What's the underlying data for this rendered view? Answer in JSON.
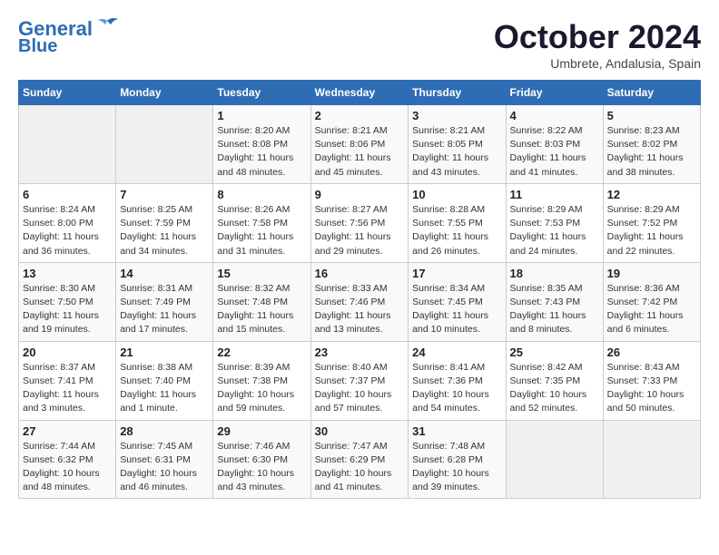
{
  "header": {
    "logo_line1": "General",
    "logo_line2": "Blue",
    "month_title": "October 2024",
    "subtitle": "Umbrete, Andalusia, Spain"
  },
  "calendar": {
    "days_of_week": [
      "Sunday",
      "Monday",
      "Tuesday",
      "Wednesday",
      "Thursday",
      "Friday",
      "Saturday"
    ],
    "weeks": [
      [
        {
          "day": "",
          "info": ""
        },
        {
          "day": "",
          "info": ""
        },
        {
          "day": "1",
          "info": "Sunrise: 8:20 AM\nSunset: 8:08 PM\nDaylight: 11 hours and 48 minutes."
        },
        {
          "day": "2",
          "info": "Sunrise: 8:21 AM\nSunset: 8:06 PM\nDaylight: 11 hours and 45 minutes."
        },
        {
          "day": "3",
          "info": "Sunrise: 8:21 AM\nSunset: 8:05 PM\nDaylight: 11 hours and 43 minutes."
        },
        {
          "day": "4",
          "info": "Sunrise: 8:22 AM\nSunset: 8:03 PM\nDaylight: 11 hours and 41 minutes."
        },
        {
          "day": "5",
          "info": "Sunrise: 8:23 AM\nSunset: 8:02 PM\nDaylight: 11 hours and 38 minutes."
        }
      ],
      [
        {
          "day": "6",
          "info": "Sunrise: 8:24 AM\nSunset: 8:00 PM\nDaylight: 11 hours and 36 minutes."
        },
        {
          "day": "7",
          "info": "Sunrise: 8:25 AM\nSunset: 7:59 PM\nDaylight: 11 hours and 34 minutes."
        },
        {
          "day": "8",
          "info": "Sunrise: 8:26 AM\nSunset: 7:58 PM\nDaylight: 11 hours and 31 minutes."
        },
        {
          "day": "9",
          "info": "Sunrise: 8:27 AM\nSunset: 7:56 PM\nDaylight: 11 hours and 29 minutes."
        },
        {
          "day": "10",
          "info": "Sunrise: 8:28 AM\nSunset: 7:55 PM\nDaylight: 11 hours and 26 minutes."
        },
        {
          "day": "11",
          "info": "Sunrise: 8:29 AM\nSunset: 7:53 PM\nDaylight: 11 hours and 24 minutes."
        },
        {
          "day": "12",
          "info": "Sunrise: 8:29 AM\nSunset: 7:52 PM\nDaylight: 11 hours and 22 minutes."
        }
      ],
      [
        {
          "day": "13",
          "info": "Sunrise: 8:30 AM\nSunset: 7:50 PM\nDaylight: 11 hours and 19 minutes."
        },
        {
          "day": "14",
          "info": "Sunrise: 8:31 AM\nSunset: 7:49 PM\nDaylight: 11 hours and 17 minutes."
        },
        {
          "day": "15",
          "info": "Sunrise: 8:32 AM\nSunset: 7:48 PM\nDaylight: 11 hours and 15 minutes."
        },
        {
          "day": "16",
          "info": "Sunrise: 8:33 AM\nSunset: 7:46 PM\nDaylight: 11 hours and 13 minutes."
        },
        {
          "day": "17",
          "info": "Sunrise: 8:34 AM\nSunset: 7:45 PM\nDaylight: 11 hours and 10 minutes."
        },
        {
          "day": "18",
          "info": "Sunrise: 8:35 AM\nSunset: 7:43 PM\nDaylight: 11 hours and 8 minutes."
        },
        {
          "day": "19",
          "info": "Sunrise: 8:36 AM\nSunset: 7:42 PM\nDaylight: 11 hours and 6 minutes."
        }
      ],
      [
        {
          "day": "20",
          "info": "Sunrise: 8:37 AM\nSunset: 7:41 PM\nDaylight: 11 hours and 3 minutes."
        },
        {
          "day": "21",
          "info": "Sunrise: 8:38 AM\nSunset: 7:40 PM\nDaylight: 11 hours and 1 minute."
        },
        {
          "day": "22",
          "info": "Sunrise: 8:39 AM\nSunset: 7:38 PM\nDaylight: 10 hours and 59 minutes."
        },
        {
          "day": "23",
          "info": "Sunrise: 8:40 AM\nSunset: 7:37 PM\nDaylight: 10 hours and 57 minutes."
        },
        {
          "day": "24",
          "info": "Sunrise: 8:41 AM\nSunset: 7:36 PM\nDaylight: 10 hours and 54 minutes."
        },
        {
          "day": "25",
          "info": "Sunrise: 8:42 AM\nSunset: 7:35 PM\nDaylight: 10 hours and 52 minutes."
        },
        {
          "day": "26",
          "info": "Sunrise: 8:43 AM\nSunset: 7:33 PM\nDaylight: 10 hours and 50 minutes."
        }
      ],
      [
        {
          "day": "27",
          "info": "Sunrise: 7:44 AM\nSunset: 6:32 PM\nDaylight: 10 hours and 48 minutes."
        },
        {
          "day": "28",
          "info": "Sunrise: 7:45 AM\nSunset: 6:31 PM\nDaylight: 10 hours and 46 minutes."
        },
        {
          "day": "29",
          "info": "Sunrise: 7:46 AM\nSunset: 6:30 PM\nDaylight: 10 hours and 43 minutes."
        },
        {
          "day": "30",
          "info": "Sunrise: 7:47 AM\nSunset: 6:29 PM\nDaylight: 10 hours and 41 minutes."
        },
        {
          "day": "31",
          "info": "Sunrise: 7:48 AM\nSunset: 6:28 PM\nDaylight: 10 hours and 39 minutes."
        },
        {
          "day": "",
          "info": ""
        },
        {
          "day": "",
          "info": ""
        }
      ]
    ]
  }
}
